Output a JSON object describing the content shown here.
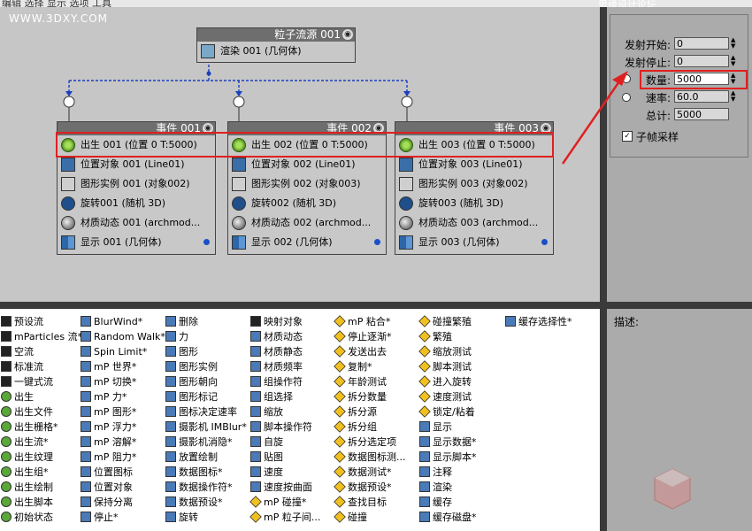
{
  "topbar": {
    "menu": "编辑  选择  显示  选项  工具",
    "watermark": "思缘设计论坛 www.missyuan.com"
  },
  "site": "WWW.3DXY.COM",
  "source_node": {
    "title": "粒子流源 001",
    "row": "渲染 001 (几何体)"
  },
  "events": [
    {
      "title": "事件 001",
      "rows": [
        "出生 001 (位置 0 T:5000)",
        "位置对象 001 (Line01)",
        "图形实例 001 (对象002)",
        "旋转001 (随机 3D)",
        "材质动态 001 (archmod...",
        "显示 001 (几何体)"
      ]
    },
    {
      "title": "事件 002",
      "rows": [
        "出生 002 (位置 0 T:5000)",
        "位置对象 002 (Line01)",
        "图形实例 002 (对象003)",
        "旋转002 (随机 3D)",
        "材质动态 002 (archmod...",
        "显示 002 (几何体)"
      ]
    },
    {
      "title": "事件 003",
      "rows": [
        "出生 003 (位置 0 T:5000)",
        "位置对象 003 (Line01)",
        "图形实例 003 (对象002)",
        "旋转003 (随机 3D)",
        "材质动态 003 (archmod...",
        "显示 003 (几何体)"
      ]
    }
  ],
  "panel": {
    "emit_start_label": "发射开始:",
    "emit_start": "0",
    "emit_stop_label": "发射停止:",
    "emit_stop": "0",
    "amount_label": "数量:",
    "amount": "5000",
    "rate_label": "速率:",
    "rate": "60.0",
    "total_label": "总计:",
    "total": "5000",
    "subframe_label": "子帧采样"
  },
  "desc_label": "描述:",
  "depot_columns": [
    [
      "预设流",
      "mParticles 流*",
      "空流",
      "标准流",
      "一键式流",
      "出生",
      "出生文件",
      "出生栅格*",
      "出生流*",
      "出生纹理",
      "出生组*",
      "出生绘制",
      "出生脚本",
      "初始状态"
    ],
    [
      "BlurWind*",
      "Random Walk*",
      "Spin Limit*",
      "mP 世界*",
      "mP 切换*",
      "mP 力*",
      "mP 图形*",
      "mP 浮力*",
      "mP 溶解*",
      "mP 阻力*",
      "位置图标",
      "位置对象",
      "保持分离",
      "停止*"
    ],
    [
      "删除",
      "力",
      "图形",
      "图形实例",
      "图形朝向",
      "图形标记",
      "图标决定速率",
      "摄影机 IMBlur*",
      "摄影机消隐*",
      "放置绘制",
      "数据图标*",
      "数据操作符*",
      "数据预设*",
      "旋转"
    ],
    [
      "映射对象",
      "材质动态",
      "材质静态",
      "材质频率",
      "组操作符",
      "组选择",
      "缩放",
      "脚本操作符",
      "自旋",
      "贴图",
      "速度",
      "速度按曲面",
      "mP 碰撞*",
      "mP 粒子间..."
    ],
    [
      "mP 粘合*",
      "停止逐渐*",
      "发送出去",
      "复制*",
      "年龄测试",
      "拆分数量",
      "拆分源",
      "拆分组",
      "拆分选定项",
      "数据图标测...",
      "数据测试*",
      "数据预设*",
      "查找目标",
      "碰撞"
    ],
    [
      "碰撞繁殖",
      "繁殖",
      "缩放测试",
      "脚本测试",
      "进入旋转",
      "速度测试",
      "锁定/粘着",
      "显示",
      "显示数据*",
      "显示脚本*",
      "注释",
      "渲染",
      "缓存",
      "缓存磁盘*"
    ],
    [
      "缓存选择性*"
    ]
  ],
  "depot_icon_kinds": [
    [
      "k",
      "k",
      "k",
      "k",
      "k",
      "g",
      "g",
      "g",
      "g",
      "g",
      "g",
      "g",
      "g",
      "g"
    ],
    [
      "b",
      "b",
      "b",
      "b",
      "b",
      "b",
      "b",
      "b",
      "b",
      "b",
      "b",
      "b",
      "b",
      "b"
    ],
    [
      "b",
      "b",
      "b",
      "b",
      "b",
      "b",
      "b",
      "b",
      "b",
      "b",
      "b",
      "b",
      "b",
      "b"
    ],
    [
      "k",
      "b",
      "b",
      "b",
      "b",
      "b",
      "b",
      "b",
      "b",
      "b",
      "b",
      "b",
      "y",
      "y"
    ],
    [
      "y",
      "y",
      "y",
      "y",
      "y",
      "y",
      "y",
      "y",
      "y",
      "y",
      "y",
      "y",
      "y",
      "y"
    ],
    [
      "y",
      "y",
      "y",
      "y",
      "y",
      "y",
      "y",
      "b",
      "b",
      "b",
      "b",
      "b",
      "b",
      "b"
    ],
    [
      "b"
    ]
  ],
  "colors": {
    "highlight": "#e02020",
    "canvas": "#c6c6c6",
    "link": "#1a3fbf"
  }
}
